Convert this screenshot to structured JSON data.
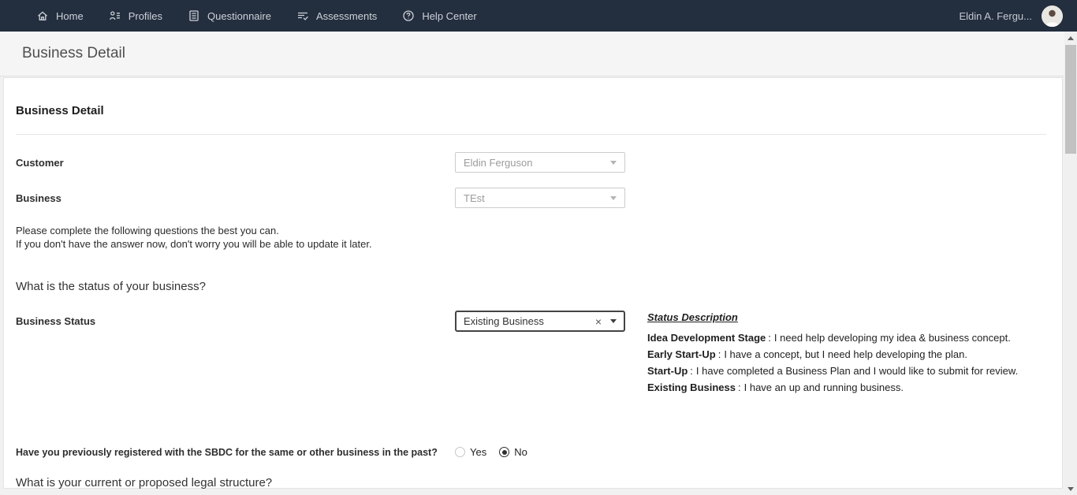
{
  "colors": {
    "navbar_bg": "#232e3e",
    "navbar_text": "#cdd2d9",
    "titlebar_bg": "#f5f5f5",
    "card_bg": "#ffffff",
    "focus_border": "#444444",
    "disabled_text": "#9b9b9b",
    "scroll_thumb": "#c1c1c1"
  },
  "navbar": {
    "items": [
      {
        "label": "Home",
        "icon": "home-icon"
      },
      {
        "label": "Profiles",
        "icon": "profiles-icon"
      },
      {
        "label": "Questionnaire",
        "icon": "questionnaire-icon"
      },
      {
        "label": "Assessments",
        "icon": "assessments-icon"
      },
      {
        "label": "Help Center",
        "icon": "help-icon"
      }
    ],
    "user": {
      "name": "Eldin A. Fergu...",
      "avatar": "user-photo"
    }
  },
  "page": {
    "title": "Business Detail"
  },
  "form": {
    "heading": "Business Detail",
    "customer": {
      "label": "Customer",
      "value": "Eldin Ferguson"
    },
    "business": {
      "label": "Business",
      "value": "TEst"
    },
    "intro_line1": "Please complete the following questions the best you can.",
    "intro_line2": "If you don't have the answer now, don't worry you will be able to update it later.",
    "status_section_heading": "What is the status of your business?",
    "business_status": {
      "label": "Business Status",
      "value": "Existing Business",
      "clear_icon": "×"
    },
    "status_description": {
      "heading": "Status Description",
      "sep": ":",
      "items": [
        {
          "term": "Idea Development Stage",
          "desc": "I need help developing my idea & business concept."
        },
        {
          "term": "Early Start-Up",
          "desc": "I have a concept, but I need help developing the plan."
        },
        {
          "term": "Start-Up",
          "desc": "I have completed a Business Plan and I would like to submit for review."
        },
        {
          "term": "Existing Business",
          "desc": "I have an up and running business."
        }
      ]
    },
    "sbdc_question": "Have you previously registered with the SBDC for the same or other business in the past?",
    "radio": {
      "yes_label": "Yes",
      "no_label": "No",
      "selected": "No"
    },
    "legal_section_heading": "What is your current or proposed legal structure?"
  }
}
